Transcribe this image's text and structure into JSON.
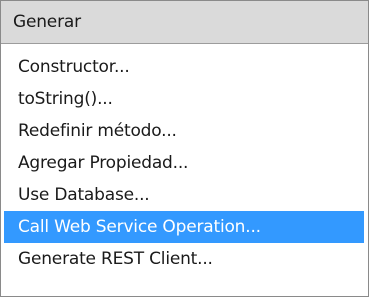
{
  "popup": {
    "title": "Generar",
    "items": [
      {
        "label": "Constructor..."
      },
      {
        "label": "toString()..."
      },
      {
        "label": "Redefinir método..."
      },
      {
        "label": "Agregar Propiedad..."
      },
      {
        "label": "Use Database..."
      },
      {
        "label": "Call Web Service Operation...",
        "selected": true
      },
      {
        "label": "Generate REST Client..."
      }
    ]
  },
  "colors": {
    "header_bg": "#dadada",
    "selection_bg": "#3399ff",
    "selection_text": "#ffffff"
  }
}
